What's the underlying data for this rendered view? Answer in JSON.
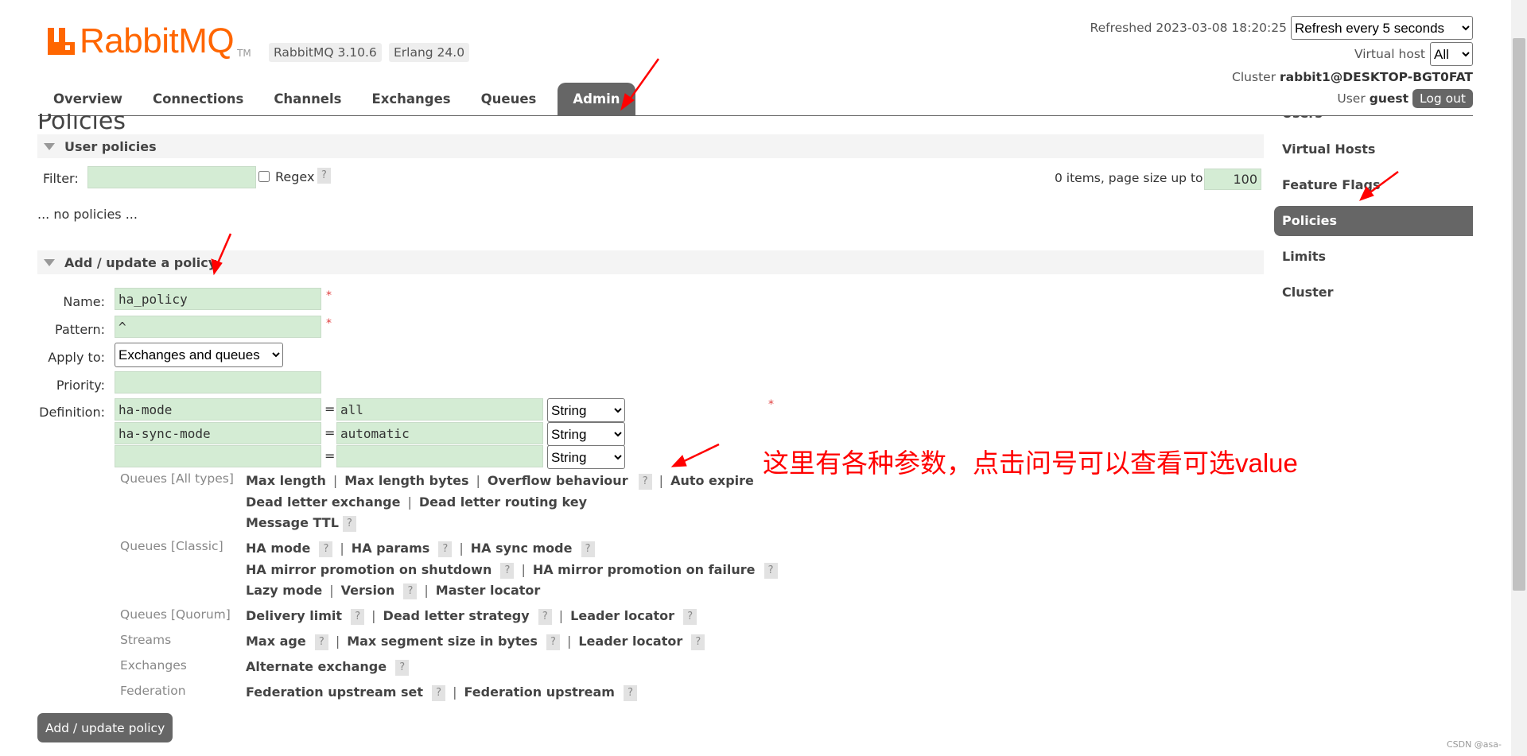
{
  "header": {
    "logo_text": "RabbitMQ",
    "logo_tm": "TM",
    "version_badge": "RabbitMQ 3.10.6",
    "erlang_badge": "Erlang 24.0",
    "refreshed_label": "Refreshed 2023-03-08 18:20:25",
    "refresh_select": "Refresh every 5 seconds",
    "vhost_label": "Virtual host",
    "vhost_select": "All",
    "cluster_label": "Cluster",
    "cluster_name": "rabbit1@DESKTOP-BGT0FAT",
    "user_label": "User",
    "user_name": "guest",
    "logout_label": "Log out"
  },
  "tabs": [
    {
      "label": "Overview"
    },
    {
      "label": "Connections"
    },
    {
      "label": "Channels"
    },
    {
      "label": "Exchanges"
    },
    {
      "label": "Queues"
    },
    {
      "label": "Admin",
      "active": true
    }
  ],
  "sidebar": {
    "items": [
      {
        "label": "Users"
      },
      {
        "label": "Virtual Hosts"
      },
      {
        "label": "Feature Flags"
      },
      {
        "label": "Policies",
        "active": true
      },
      {
        "label": "Limits"
      },
      {
        "label": "Cluster"
      }
    ]
  },
  "page_title": "Policies",
  "user_policies": {
    "title": "User policies",
    "filter_label": "Filter:",
    "filter_value": "",
    "regex_label": "Regex",
    "help": "?",
    "items_label": "0 items, page size up to",
    "page_size": "100",
    "empty": "... no policies ..."
  },
  "add_policy": {
    "title": "Add / update a policy",
    "name_label": "Name:",
    "name_value": "ha_policy",
    "pattern_label": "Pattern:",
    "pattern_value": "^",
    "required_mark": "*",
    "apply_label": "Apply to:",
    "apply_value": "Exchanges and queues",
    "priority_label": "Priority:",
    "priority_value": "",
    "definition_label": "Definition:",
    "eq": "=",
    "definitions": [
      {
        "key": "ha-mode",
        "value": "all",
        "type": "String"
      },
      {
        "key": "ha-sync-mode",
        "value": "automatic",
        "type": "String"
      },
      {
        "key": "",
        "value": "",
        "type": "String"
      }
    ],
    "categories": {
      "queues_all": "Queues [All types]",
      "queues_classic": "Queues [Classic]",
      "queues_quorum": "Queues [Quorum]",
      "streams": "Streams",
      "exchanges": "Exchanges",
      "federation": "Federation"
    },
    "keys": {
      "max_length": "Max length",
      "max_length_bytes": "Max length bytes",
      "overflow": "Overflow behaviour",
      "auto_expire": "Auto expire",
      "dlx": "Dead letter exchange",
      "dlrk": "Dead letter routing key",
      "msg_ttl": "Message TTL",
      "ha_mode": "HA mode",
      "ha_params": "HA params",
      "ha_sync_mode": "HA sync mode",
      "ha_promo_shutdown": "HA mirror promotion on shutdown",
      "ha_promo_failure": "HA mirror promotion on failure",
      "lazy_mode": "Lazy mode",
      "version": "Version",
      "master_locator": "Master locator",
      "delivery_limit": "Delivery limit",
      "dl_strategy": "Dead letter strategy",
      "leader_locator": "Leader locator",
      "max_age": "Max age",
      "max_segment": "Max segment size in bytes",
      "alt_exchange": "Alternate exchange",
      "fed_upstream_set": "Federation upstream set",
      "fed_upstream": "Federation upstream"
    },
    "submit_label": "Add / update policy"
  },
  "annotation": {
    "note": "这里有各种参数，点击问号可以查看可选value",
    "stray_mark": "*",
    "arrow_color": "#ff0000"
  },
  "watermark": "CSDN @asa-"
}
